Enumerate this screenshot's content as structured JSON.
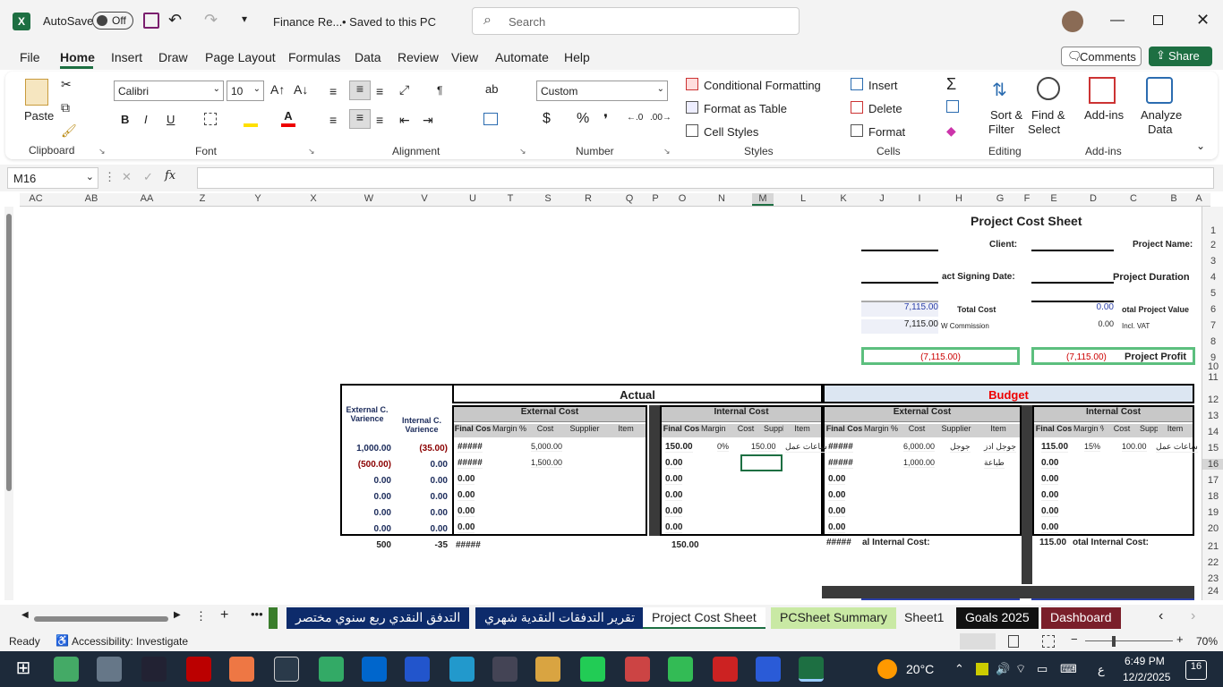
{
  "titlebar": {
    "autosave": "AutoSave",
    "toggle": "Off",
    "filename": "Finance Re...",
    "saved": "• Saved to this PC",
    "search_placeholder": "Search"
  },
  "menu": [
    "File",
    "Home",
    "Insert",
    "Draw",
    "Page Layout",
    "Formulas",
    "Data",
    "Review",
    "View",
    "Automate",
    "Help"
  ],
  "menu_right": {
    "comments": "Comments",
    "share": "Share"
  },
  "ribbon": {
    "clipboard": {
      "paste": "Paste",
      "group": "Clipboard"
    },
    "font": {
      "name": "Calibri",
      "size": "10",
      "group": "Font"
    },
    "alignment": {
      "group": "Alignment"
    },
    "number": {
      "format": "Custom",
      "group": "Number"
    },
    "styles": {
      "cond": "Conditional Formatting",
      "table": "Format as Table",
      "cell": "Cell Styles",
      "group": "Styles"
    },
    "cells": {
      "insert": "Insert",
      "delete": "Delete",
      "format": "Format",
      "group": "Cells"
    },
    "editing": {
      "sort": "Sort &",
      "sort2": "Filter",
      "find": "Find &",
      "find2": "Select",
      "group": "Editing"
    },
    "addins": {
      "label": "Add-ins",
      "group": "Add-ins"
    },
    "analyze": {
      "l1": "Analyze",
      "l2": "Data"
    }
  },
  "namebox": "M16",
  "columns": [
    "AC",
    "AB",
    "AA",
    "Z",
    "Y",
    "X",
    "W",
    "V",
    "U",
    "T",
    "S",
    "R",
    "Q",
    "P",
    "O",
    "N",
    "M",
    "L",
    "K",
    "J",
    "I",
    "H",
    "G",
    "F",
    "E",
    "D",
    "C",
    "B",
    "A"
  ],
  "rows": [
    "1",
    "2",
    "3",
    "4",
    "5",
    "6",
    "7",
    "8",
    "9",
    "10",
    "11",
    "12",
    "13",
    "14",
    "15",
    "16",
    "17",
    "18",
    "19",
    "20",
    "21",
    "22",
    "23",
    "24"
  ],
  "sheet": {
    "title": "Project Cost Sheet",
    "client": "Client:",
    "project_name": "Project Name:",
    "signing": "act Signing Date:",
    "duration": "Project Duration",
    "total_cost_val": "7,115.00",
    "total_cost": "Total Cost",
    "tpv_val": "0.00",
    "tpv": "otal Project Value",
    "commission_val": "7,115.00",
    "commission": "W Commission",
    "incl_vat_val": "0.00",
    "incl_vat": "Incl. VAT",
    "profit_left": "(7,115.00)",
    "profit_right": "(7,115.00)",
    "profit": "Project Profit",
    "actual": "Actual",
    "budget": "Budget",
    "ext_var": "External C. Varience",
    "int_var": "Internal C. Varience",
    "external_cost": "External Cost",
    "internal_cost": "Internal Cost",
    "h_final": "Final Cos",
    "h_margin": "Margin %",
    "h_cost": "Cost",
    "h_supplier": "Supplier",
    "h_item": "Item",
    "var_rows": [
      [
        "1,000.00",
        "(35.00)"
      ],
      [
        "(500.00)",
        "0.00"
      ],
      [
        "0.00",
        "0.00"
      ],
      [
        "0.00",
        "0.00"
      ],
      [
        "0.00",
        "0.00"
      ],
      [
        "0.00",
        "0.00"
      ]
    ],
    "var_totals": [
      "500",
      "-35"
    ],
    "act_ext": [
      [
        "#####",
        "",
        "5,000.00",
        "",
        ""
      ],
      [
        "#####",
        "",
        "1,500.00",
        "",
        ""
      ],
      [
        "0.00",
        "",
        "",
        "",
        ""
      ],
      [
        "0.00",
        "",
        "",
        "",
        ""
      ],
      [
        "0.00",
        "",
        "",
        "",
        ""
      ],
      [
        "0.00",
        "",
        "",
        "",
        ""
      ]
    ],
    "act_ext_total": "#####",
    "act_int": [
      [
        "150.00",
        "0%",
        "150.00",
        "",
        "ساعات عمل"
      ],
      [
        "0.00",
        "",
        "",
        "",
        ""
      ],
      [
        "0.00",
        "",
        "",
        "",
        ""
      ],
      [
        "0.00",
        "",
        "",
        "",
        ""
      ],
      [
        "0.00",
        "",
        "",
        "",
        ""
      ],
      [
        "0.00",
        "",
        "",
        "",
        ""
      ]
    ],
    "act_int_total": "150.00",
    "bud_ext": [
      [
        "#####",
        "",
        "6,000.00",
        "جوجل",
        "جوجل ادز"
      ],
      [
        "#####",
        "",
        "1,000.00",
        "",
        "طباعة"
      ],
      [
        "0.00",
        "",
        "",
        "",
        ""
      ],
      [
        "0.00",
        "",
        "",
        "",
        ""
      ],
      [
        "0.00",
        "",
        "",
        "",
        ""
      ],
      [
        "0.00",
        "",
        "",
        "",
        ""
      ]
    ],
    "bud_ext_total": "#####",
    "bud_ext_total_lbl": "al Internal Cost:",
    "bud_int": [
      [
        "115.00",
        "15%",
        "100.00",
        "",
        "ساعات عمل"
      ],
      [
        "0.00",
        "",
        "",
        "",
        ""
      ],
      [
        "0.00",
        "",
        "",
        "",
        ""
      ],
      [
        "0.00",
        "",
        "",
        "",
        ""
      ],
      [
        "0.00",
        "",
        "",
        "",
        ""
      ],
      [
        "0.00",
        "",
        "",
        "",
        ""
      ]
    ],
    "bud_int_total": "115.00",
    "bud_int_total_lbl": "otal Internal Cost:"
  },
  "tabs": [
    "التدفق النقدي ربع سنوي مختصر",
    "تقرير التدفقات النقدية شهري",
    "Project Cost Sheet",
    "PCSheet Summary",
    "Sheet1",
    "Goals 2025",
    "Dashboard"
  ],
  "status": {
    "ready": "Ready",
    "access": "Accessibility: Investigate",
    "zoom": "70%"
  },
  "taskbar": {
    "temp": "20°C",
    "time": "6:49 PM",
    "date": "12/2/2025",
    "lang": "ع",
    "notif": "16"
  }
}
